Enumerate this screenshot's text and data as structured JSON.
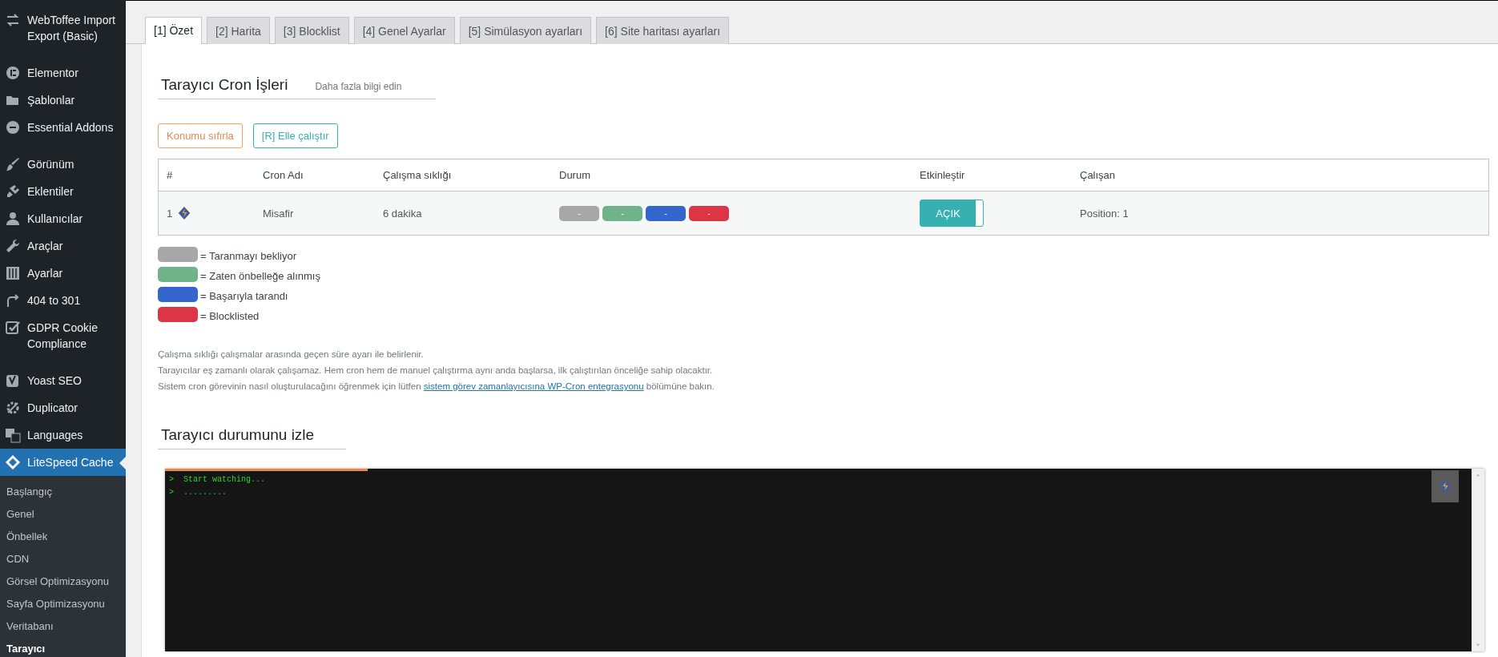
{
  "sidebar": {
    "groups": [
      {
        "items": [
          {
            "label": "WebToffee Import Export (Basic)",
            "selected": false
          }
        ]
      },
      {
        "items": [
          {
            "label": "Elementor",
            "selected": false
          },
          {
            "label": "Şablonlar",
            "selected": false
          },
          {
            "label": "Essential Addons",
            "selected": false
          }
        ]
      },
      {
        "items": [
          {
            "label": "Görünüm",
            "selected": false
          },
          {
            "label": "Eklentiler",
            "selected": false
          },
          {
            "label": "Kullanıcılar",
            "selected": false
          },
          {
            "label": "Araçlar",
            "selected": false
          },
          {
            "label": "Ayarlar",
            "selected": false
          },
          {
            "label": "404 to 301",
            "selected": false
          },
          {
            "label": "GDPR Cookie Compliance",
            "selected": false
          }
        ]
      },
      {
        "items": [
          {
            "label": "Yoast SEO",
            "selected": false
          },
          {
            "label": "Duplicator",
            "selected": false
          },
          {
            "label": "Languages",
            "selected": false
          },
          {
            "label": "LiteSpeed Cache",
            "selected": true,
            "children": [
              {
                "label": "Başlangıç",
                "selected": false
              },
              {
                "label": "Genel",
                "selected": false
              },
              {
                "label": "Önbellek",
                "selected": false
              },
              {
                "label": "CDN",
                "selected": false
              },
              {
                "label": "Görsel Optimizasyonu",
                "selected": false
              },
              {
                "label": "Sayfa Optimizasyonu",
                "selected": false
              },
              {
                "label": "Veritabanı",
                "selected": false
              },
              {
                "label": "Tarayıcı",
                "selected": true
              }
            ]
          }
        ]
      }
    ]
  },
  "tabs": [
    {
      "label": "[1] Özet",
      "selected": true
    },
    {
      "label": "[2] Harita",
      "selected": false
    },
    {
      "label": "[3] Blocklist",
      "selected": false
    },
    {
      "label": "[4] Genel Ayarlar",
      "selected": false
    },
    {
      "label": "[5] Simülasyon ayarları",
      "selected": false
    },
    {
      "label": "[6] Site haritası ayarları",
      "selected": false
    }
  ],
  "cron_section": {
    "title": "Tarayıcı Cron İşleri",
    "help_link": "Daha fazla bilgi edin",
    "buttons": [
      {
        "label": "Konumu sıfırla",
        "kind": "warning"
      },
      {
        "label": "[R] Elle çalıştır",
        "kind": "primary"
      }
    ],
    "table": {
      "columns": [
        "#",
        "Cron Adı",
        "Çalışma sıklığı",
        "Durum",
        "Etkinleştir",
        "Çalışan"
      ],
      "rows": [
        {
          "number": "1",
          "name": "Misafir",
          "frequency": "6 dakika",
          "statuses": [
            {
              "label": "-",
              "color": "#a7a7a7"
            },
            {
              "label": "-",
              "color": "#6fb38a"
            },
            {
              "label": "-",
              "color": "#3366cc"
            },
            {
              "label": "-",
              "color": "#dc3545"
            }
          ],
          "toggle": {
            "label": "AÇIK",
            "on": true
          },
          "worker": "Position: 1"
        }
      ]
    },
    "legend": [
      {
        "label": "= Taranmayı bekliyor",
        "color": "#a7a7a7"
      },
      {
        "label": "= Zaten önbelleğe alınmış",
        "color": "#6fb38a"
      },
      {
        "label": "= Başarıyla tarandı",
        "color": "#3366cc"
      },
      {
        "label": "= Blocklisted",
        "color": "#dc3545"
      }
    ],
    "notes": [
      "Çalışma sıklığı çalışmalar arasında geçen süre ayarı ile belirlenir.",
      "Tarayıcılar eş zamanlı olarak çalışamaz. Hem cron hem de manuel çalıştırma aynı anda başlarsa, ilk çalıştırılan önceliğe sahip olacaktır."
    ],
    "note_link": {
      "before": "Sistem cron görevinin nasıl oluşturulacağını öğrenmek için lütfen",
      "link": "sistem görev zamanlayıcısına WP-Cron entegrasyonu",
      "after": "bölümüne bakın."
    }
  },
  "watch_section": {
    "title": "Tarayıcı durumunu izle",
    "progress": {
      "level": 0.155
    },
    "lines": [
      {
        "prompt": ">",
        "text": "Start watching..."
      },
      {
        "prompt": ">",
        "text": "........."
      }
    ]
  }
}
